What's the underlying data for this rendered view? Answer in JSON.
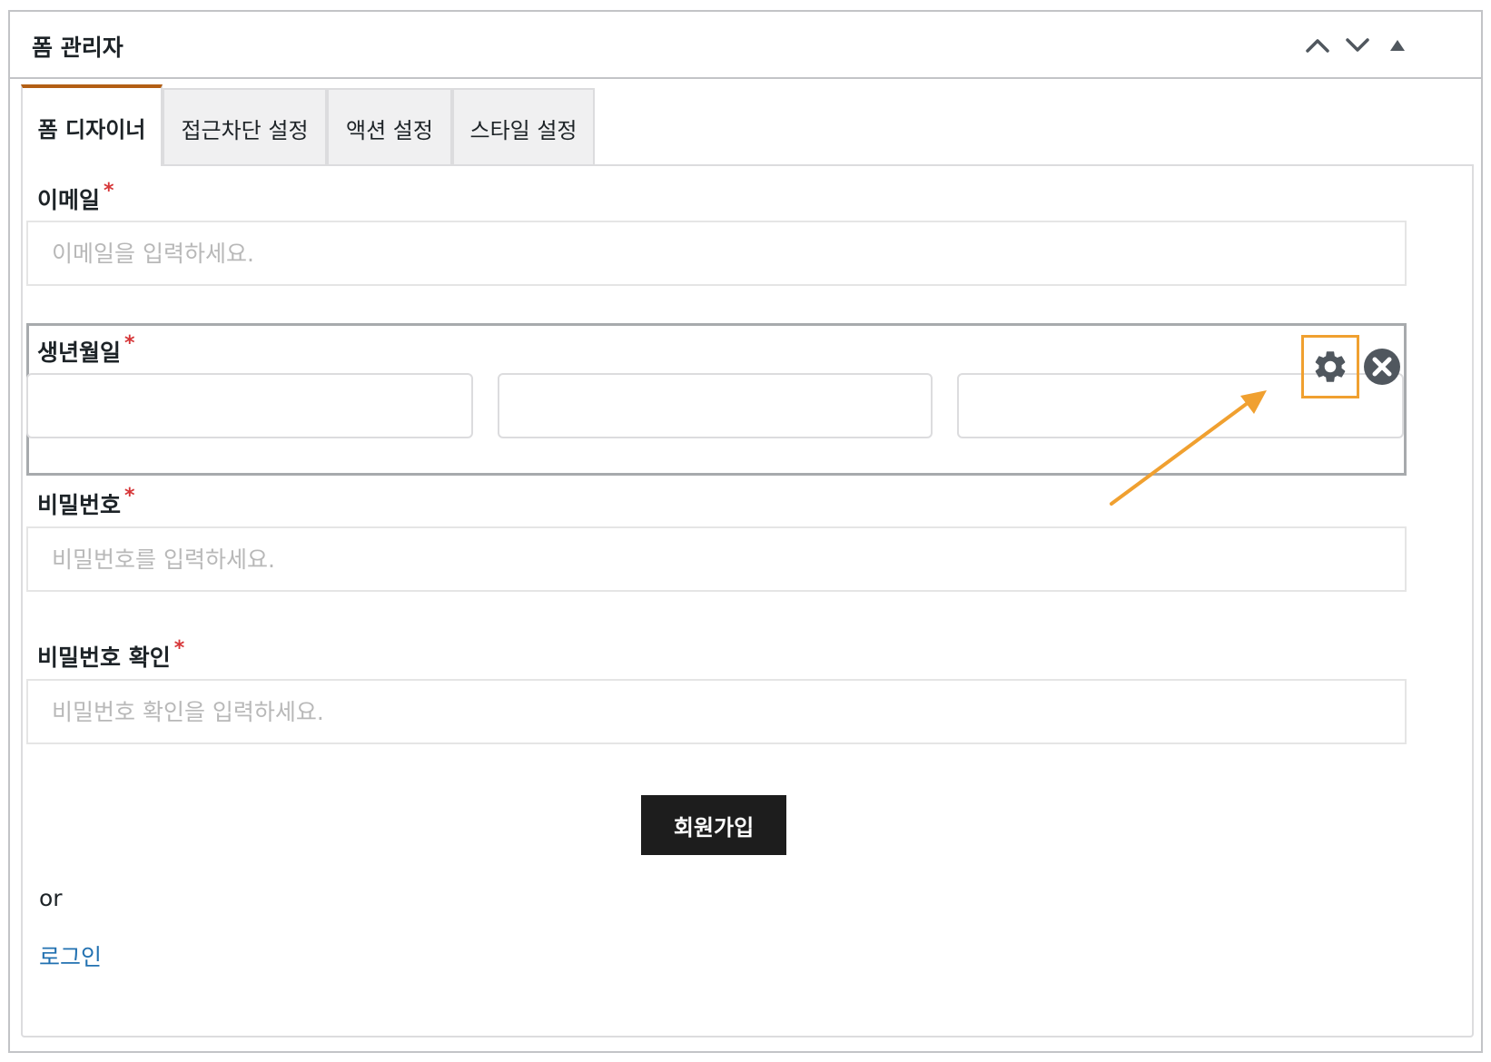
{
  "panel": {
    "title": "폼 관리자",
    "controls": [
      "chevron-up-icon",
      "chevron-down-icon",
      "triangle-up-icon"
    ]
  },
  "tabs": [
    {
      "label": "폼 디자이너",
      "active": true
    },
    {
      "label": "접근차단 설정",
      "active": false
    },
    {
      "label": "액션 설정",
      "active": false
    },
    {
      "label": "스타일 설정",
      "active": false
    }
  ],
  "required_marker": "*",
  "form": {
    "email": {
      "label": "이메일",
      "placeholder": "이메일을 입력하세요."
    },
    "birthdate": {
      "label": "생년월일",
      "tools": [
        "gear-icon",
        "close-icon"
      ]
    },
    "password": {
      "label": "비밀번호",
      "placeholder": "비밀번호를 입력하세요."
    },
    "password_confirm": {
      "label": "비밀번호 확인",
      "placeholder": "비밀번호 확인을 입력하세요."
    },
    "submit_label": "회원가입",
    "or_text": "or",
    "login_link": "로그인"
  },
  "colors": {
    "active_tab_accent": "#b35f14",
    "required": "#d63638",
    "annotation": "#f0a030",
    "link": "#2271b1",
    "submit_bg": "#1d1d1d"
  }
}
